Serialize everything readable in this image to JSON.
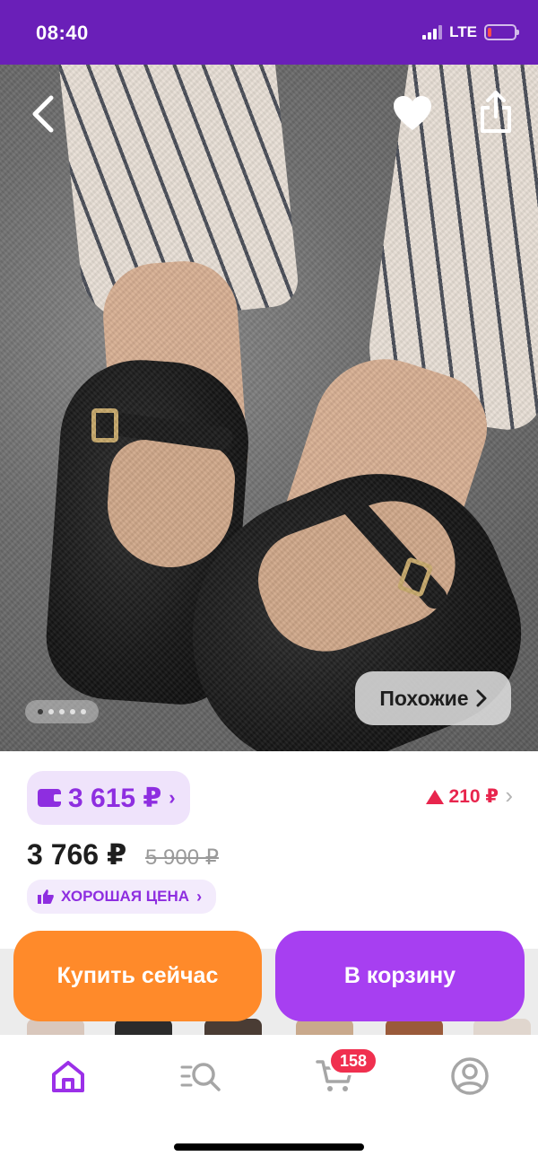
{
  "status_bar": {
    "time": "08:40",
    "network": "LTE",
    "battery_level": 0.15,
    "battery_color": "#ff4a4a"
  },
  "hero": {
    "image_description": "black velvet Mary Jane flats with gold buckle",
    "similar_label": "Похожие",
    "gallery_index": 1,
    "gallery_total": 5
  },
  "price": {
    "wallet_price": "3 615 ₽",
    "price_change": "210 ₽",
    "current_price": "3 766 ₽",
    "old_price": "5 900 ₽",
    "badge": "ХОРОШАЯ ЦЕНА"
  },
  "actions": {
    "buy_now": "Купить сейчас",
    "add_to_cart": "В корзину"
  },
  "tab_bar": {
    "cart_count": "158",
    "active_tab": "home"
  },
  "colors": {
    "brand": "#6a1fb8",
    "accent_purple": "#a73ff1",
    "buy_orange": "#ff8a2a",
    "alert_red": "#e8254d"
  }
}
